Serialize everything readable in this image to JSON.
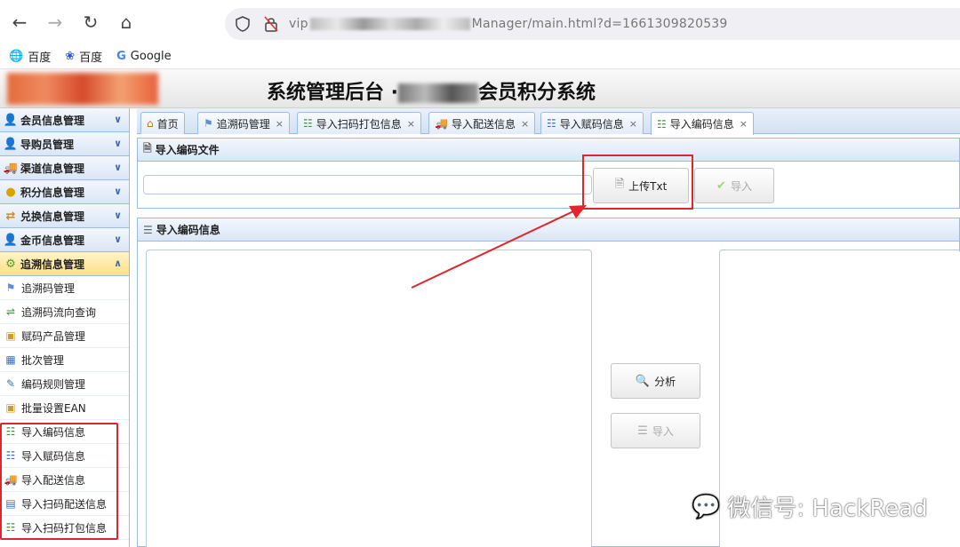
{
  "browser": {
    "url_prefix": "vip",
    "url_suffix": "Manager/main.html?d=1661309820539",
    "bookmarks": [
      {
        "label": "百度",
        "icon": "globe-icon"
      },
      {
        "label": "百度",
        "icon": "baidu-paw-icon"
      },
      {
        "label": "Google",
        "icon": "google-icon"
      }
    ]
  },
  "header": {
    "title_left": "系统管理后台 ·",
    "title_right": "会员积分系统"
  },
  "sidebar": {
    "categories": [
      {
        "label": "会员信息管理",
        "icon": "user-icon"
      },
      {
        "label": "导购员管理",
        "icon": "user-red-icon"
      },
      {
        "label": "渠道信息管理",
        "icon": "truck-icon"
      },
      {
        "label": "积分信息管理",
        "icon": "coins-icon"
      },
      {
        "label": "兑换信息管理",
        "icon": "exchange-icon"
      },
      {
        "label": "金币信息管理",
        "icon": "gold-user-icon"
      },
      {
        "label": "追溯信息管理",
        "icon": "trace-icon",
        "active": true
      }
    ],
    "items": [
      {
        "label": "追溯码管理",
        "icon": "tag-icon"
      },
      {
        "label": "追溯码流向查询",
        "icon": "flow-icon"
      },
      {
        "label": "赋码产品管理",
        "icon": "box-icon"
      },
      {
        "label": "批次管理",
        "icon": "batch-icon"
      },
      {
        "label": "编码规则管理",
        "icon": "rule-icon"
      },
      {
        "label": "批量设置EAN",
        "icon": "ean-icon"
      },
      {
        "label": "导入编码信息",
        "icon": "import-code-icon"
      },
      {
        "label": "导入赋码信息",
        "icon": "import-assign-icon"
      },
      {
        "label": "导入配送信息",
        "icon": "import-delivery-icon"
      },
      {
        "label": "导入扫码配送信息",
        "icon": "import-scan-delivery-icon"
      },
      {
        "label": "导入扫码打包信息",
        "icon": "import-scan-pack-icon"
      }
    ]
  },
  "tabs": [
    {
      "label": "首页",
      "icon": "home-icon",
      "closable": false
    },
    {
      "label": "追溯码管理",
      "icon": "tag-icon",
      "closable": true
    },
    {
      "label": "导入扫码打包信息",
      "icon": "import-scan-pack-icon",
      "closable": true
    },
    {
      "label": "导入配送信息",
      "icon": "import-delivery-icon",
      "closable": true
    },
    {
      "label": "导入赋码信息",
      "icon": "import-assign-icon",
      "closable": true
    },
    {
      "label": "导入编码信息",
      "icon": "import-code-icon",
      "closable": true,
      "active": true
    }
  ],
  "upload_panel": {
    "title": "导入编码文件",
    "upload_button": "上传Txt",
    "import_button": "导入"
  },
  "info_panel": {
    "title": "导入编码信息",
    "analyze_button": "分析",
    "import_button": "导入"
  },
  "watermark": "微信号: HackRead"
}
